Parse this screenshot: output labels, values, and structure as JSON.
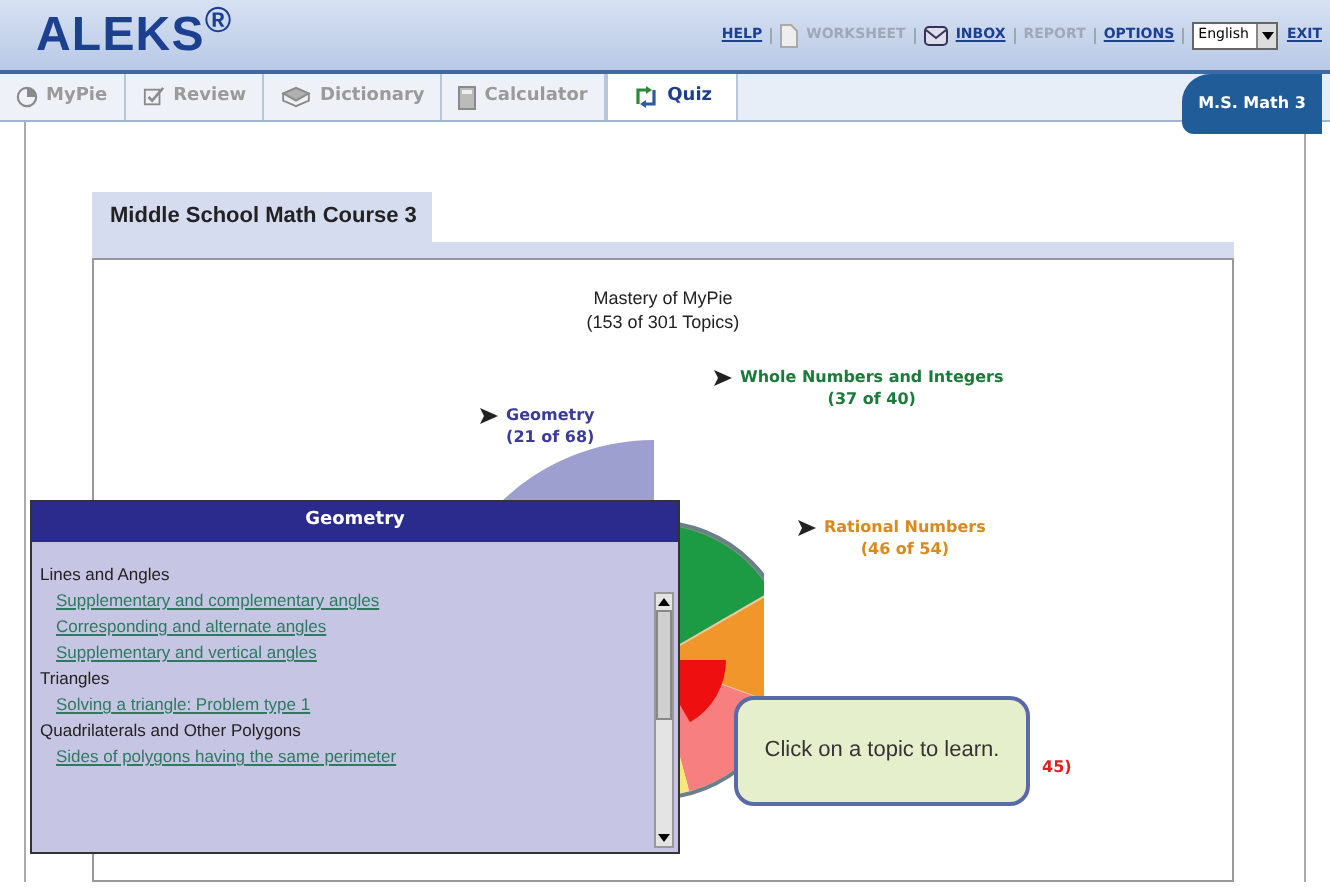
{
  "header": {
    "logo": "ALEKS$^{®}$",
    "links": [
      {
        "label": "HELP",
        "kind": "link",
        "disabled": false
      },
      {
        "label": "WORKSHEET",
        "kind": "worksheet",
        "disabled": true
      },
      {
        "label": "INBOX",
        "kind": "inbox",
        "disabled": false
      },
      {
        "label": "REPORT",
        "kind": "link",
        "disabled": true
      },
      {
        "label": "OPTIONS",
        "kind": "link",
        "disabled": false
      }
    ],
    "language": "English",
    "exit": "EXIT"
  },
  "tabs": [
    {
      "label": "MyPie",
      "kind": "pie",
      "selected": false
    },
    {
      "label": "Review",
      "kind": "review",
      "selected": false
    },
    {
      "label": "Dictionary",
      "kind": "book",
      "selected": false
    },
    {
      "label": "Calculator",
      "kind": "calculator",
      "selected": false
    },
    {
      "label": "Quiz",
      "kind": "quiz",
      "selected": true
    }
  ],
  "course_badge": "M.S. Math 3",
  "course_tab": "Middle School Math Course 3",
  "chart": {
    "title": "Mastery of MyPie",
    "subtitle": "(153 of 301 Topics)",
    "labels": [
      {
        "lines": [
          "Geometry",
          "(21 of 68)"
        ],
        "color": "#3b3b9e",
        "arrow": true
      },
      {
        "lines": [
          "Whole Numbers and Integers",
          "(37 of 40)"
        ],
        "color": "#1c7a3a",
        "arrow": true
      },
      {
        "lines": [
          "Rational Numbers",
          "(46 of 54)"
        ],
        "color": "#d88a1e",
        "arrow": true
      },
      {
        "lines": [
          "45)"
        ],
        "color": "#e02020",
        "arrow": false
      }
    ]
  },
  "popup": {
    "title": "Geometry",
    "groups": [
      {
        "heading": "Lines and Angles",
        "links": [
          "Supplementary and complementary angles",
          "Corresponding and alternate angles",
          "Supplementary and vertical angles"
        ]
      },
      {
        "heading": "Triangles",
        "links": [
          "Solving a triangle: Problem type 1"
        ]
      },
      {
        "heading": "Quadrilaterals and Other Polygons",
        "links": [
          "Sides of polygons having the same perimeter"
        ]
      }
    ]
  },
  "bubble": "Click on a topic to learn."
}
